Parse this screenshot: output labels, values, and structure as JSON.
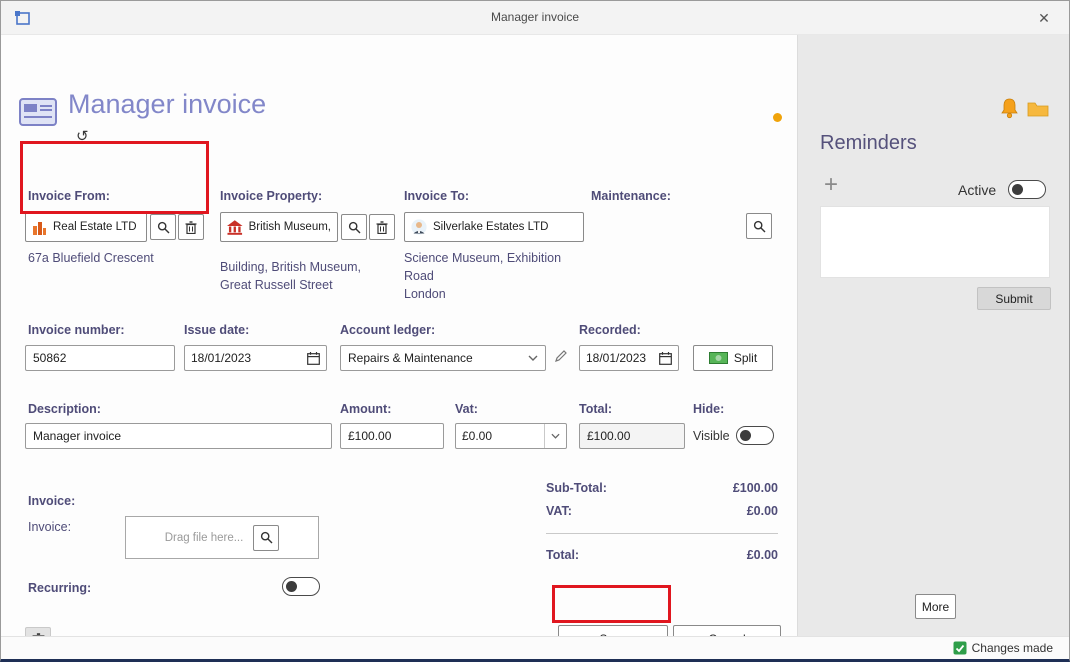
{
  "window": {
    "title": "Manager invoice",
    "close_glyph": "✕"
  },
  "header": {
    "title": "Manager invoice",
    "status_dot_color": "#f0a30a"
  },
  "colors": {
    "accent_purple": "#4f4c78",
    "heading_purple": "#8287c9",
    "highlight_red": "#e0161f",
    "status_green": "#2e9e49"
  },
  "form": {
    "invoice_from": {
      "label": "Invoice From:",
      "value": "Real Estate LTD",
      "address": "67a Bluefield Crescent"
    },
    "invoice_property": {
      "label": "Invoice Property:",
      "value": "British Museum,",
      "address_line1": "Building, British Museum,",
      "address_line2": "Great Russell Street"
    },
    "invoice_to": {
      "label": "Invoice To:",
      "value": "Silverlake Estates LTD",
      "address_line1": "Science Museum, Exhibition Road",
      "address_line2": "London"
    },
    "maintenance": {
      "label": "Maintenance:"
    },
    "invoice_number": {
      "label": "Invoice number:",
      "value": "50862"
    },
    "issue_date": {
      "label": "Issue date:",
      "value": "18/01/2023"
    },
    "account_ledger": {
      "label": "Account ledger:",
      "value": "Repairs & Maintenance"
    },
    "recorded": {
      "label": "Recorded:",
      "value": "18/01/2023",
      "split_label": "Split"
    },
    "description": {
      "label": "Description:",
      "value": "Manager invoice"
    },
    "amount": {
      "label": "Amount:",
      "value": "£100.00"
    },
    "vat": {
      "label": "Vat:",
      "value": "£0.00"
    },
    "total": {
      "label": "Total:",
      "value": "£100.00"
    },
    "hide": {
      "label": "Hide:",
      "state_label": "Visible"
    },
    "invoice_file": {
      "section_label": "Invoice:",
      "field_label": "Invoice:",
      "placeholder": "Drag file here..."
    },
    "recurring": {
      "label": "Recurring:"
    },
    "totals": {
      "subtotal_label": "Sub-Total:",
      "subtotal_value": "£100.00",
      "vat_label": "VAT:",
      "vat_value": "£0.00",
      "total_label": "Total:",
      "total_value": "£0.00"
    }
  },
  "actions": {
    "save": "Save",
    "cancel": "Cancel"
  },
  "reminders": {
    "title": "Reminders",
    "plus_glyph": "+",
    "active_label": "Active",
    "submit": "Submit",
    "more": "More"
  },
  "statusbar": {
    "changes": "Changes made"
  }
}
